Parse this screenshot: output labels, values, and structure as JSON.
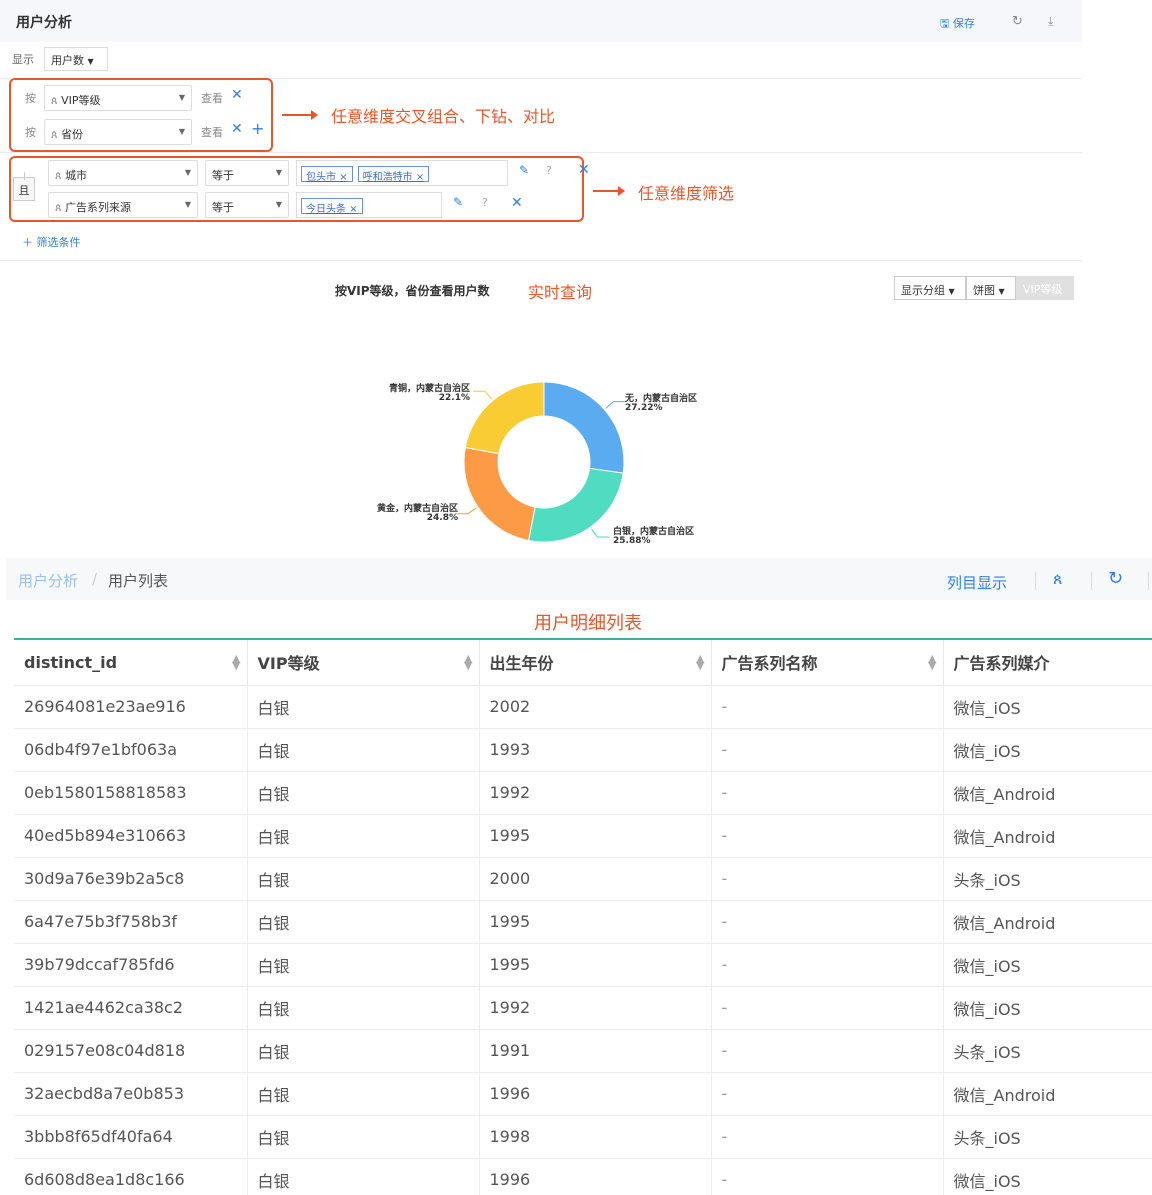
{
  "header": {
    "title": "用户分析",
    "save_label": "保存"
  },
  "display": {
    "label": "显示",
    "metric": "用户数"
  },
  "group_by": {
    "by_label": "按",
    "view_label": "查看",
    "rows": [
      {
        "dimension": "VIP等级"
      },
      {
        "dimension": "省份"
      }
    ]
  },
  "filters": {
    "and_label": "且",
    "rows": [
      {
        "dimension": "城市",
        "operator": "等于",
        "values": [
          "包头市",
          "呼和浩特市"
        ]
      },
      {
        "dimension": "广告系列来源",
        "operator": "等于",
        "values": [
          "今日头条"
        ]
      }
    ],
    "add_label": "筛选条件"
  },
  "annotations": {
    "groupby": "任意维度交叉组合、下钻、对比",
    "filter": "任意维度筛选",
    "realtime": "实时查询",
    "table": "用户明细列表"
  },
  "chart_controls": {
    "group_display": "显示分组",
    "chart_type": "饼图",
    "vip": "VIP等级"
  },
  "chart_data": {
    "type": "pie",
    "title": "按VIP等级，省份查看用户数",
    "donut": true,
    "slices": [
      {
        "label": "无，内蒙古自治区",
        "value": 27.22,
        "color": "#5aabf0"
      },
      {
        "label": "白银，内蒙古自治区",
        "value": 25.88,
        "color": "#4fdcc0"
      },
      {
        "label": "黄金，内蒙古自治区",
        "value": 24.8,
        "color": "#fd9a45"
      },
      {
        "label": "青铜，内蒙古自治区",
        "value": 22.1,
        "color": "#f9cc33"
      }
    ]
  },
  "breadcrumb": {
    "parent": "用户分析",
    "separator": "/",
    "current": "用户列表"
  },
  "table_controls": {
    "column_display": "列目显示"
  },
  "table": {
    "columns": [
      "distinct_id",
      "VIP等级",
      "出生年份",
      "广告系列名称",
      "广告系列媒介"
    ],
    "rows": [
      [
        "26964081e23ae916",
        "白银",
        "2002",
        "-",
        "微信_iOS"
      ],
      [
        "06db4f97e1bf063a",
        "白银",
        "1993",
        "-",
        "微信_iOS"
      ],
      [
        "0eb1580158818583",
        "白银",
        "1992",
        "-",
        "微信_Android"
      ],
      [
        "40ed5b894e310663",
        "白银",
        "1995",
        "-",
        "微信_Android"
      ],
      [
        "30d9a76e39b2a5c8",
        "白银",
        "2000",
        "-",
        "头条_iOS"
      ],
      [
        "6a47e75b3f758b3f",
        "白银",
        "1995",
        "-",
        "微信_Android"
      ],
      [
        "39b79dccaf785fd6",
        "白银",
        "1995",
        "-",
        "微信_iOS"
      ],
      [
        "1421ae4462ca38c2",
        "白银",
        "1992",
        "-",
        "微信_iOS"
      ],
      [
        "029157e08c04d818",
        "白银",
        "1991",
        "-",
        "头条_iOS"
      ],
      [
        "32aecbd8a7e0b853",
        "白银",
        "1996",
        "-",
        "微信_Android"
      ],
      [
        "3bbb8f65df40fa64",
        "白银",
        "1998",
        "-",
        "头条_iOS"
      ],
      [
        "6d608d8ea1d8c166",
        "白银",
        "1996",
        "-",
        "微信_iOS"
      ]
    ]
  }
}
